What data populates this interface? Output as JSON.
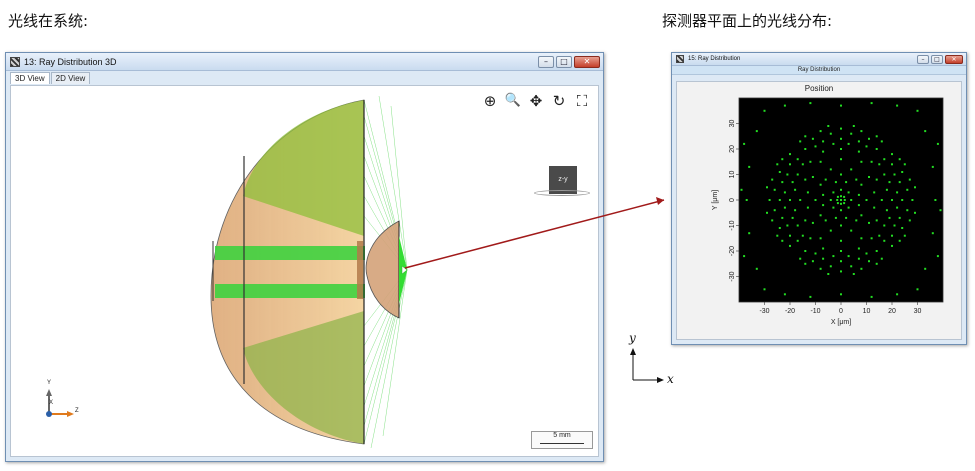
{
  "captions": {
    "left": "光线在系统:",
    "right": "探测器平面上的光线分布:"
  },
  "window_3d": {
    "title": "13: Ray Distribution 3D",
    "tabs": [
      "3D View",
      "2D View"
    ],
    "active_tab": "3D View",
    "buttons": {
      "minimize": "–",
      "maximize": "□",
      "close": "✕"
    },
    "toolbar": [
      {
        "name": "zoom-window-icon",
        "glyph": "⊕"
      },
      {
        "name": "zoom-icon",
        "glyph": "🔍"
      },
      {
        "name": "pan-icon",
        "glyph": "✥"
      },
      {
        "name": "rotate-icon",
        "glyph": "↻"
      },
      {
        "name": "fit-view-icon",
        "glyph": "⛶"
      }
    ],
    "viewcube_label": "z-y",
    "triad": {
      "y": "Y",
      "x": "X",
      "z": "Z"
    },
    "scalebar_label": "5 mm",
    "colors": {
      "lens_fill": "#e8b27a",
      "ray": "#22cc22",
      "lens_edge": "#222222"
    }
  },
  "window_detector": {
    "title": "15: Ray Distribution",
    "header": "Ray Distribution",
    "buttons": {
      "minimize": "–",
      "maximize": "□",
      "close": "✕"
    }
  },
  "chart_data": {
    "type": "scatter",
    "title": "Position",
    "xlabel": "X [μm]",
    "ylabel": "Y [μm]",
    "xlim": [
      -40,
      40
    ],
    "ylim": [
      -40,
      40
    ],
    "xticks": [
      -30,
      -20,
      -10,
      0,
      10,
      20,
      30
    ],
    "yticks": [
      30,
      20,
      10,
      0,
      -10,
      -20,
      -30
    ],
    "background": "#000000",
    "point_color": "#22dd22",
    "grid": false,
    "legend": "none",
    "points": [
      [
        0,
        0
      ],
      [
        1.5,
        0
      ],
      [
        -1.5,
        0
      ],
      [
        0,
        1.5
      ],
      [
        0,
        -1.5
      ],
      [
        1.2,
        1.2
      ],
      [
        -1.2,
        1.2
      ],
      [
        1.2,
        -1.2
      ],
      [
        -1.2,
        -1.2
      ],
      [
        4,
        0
      ],
      [
        -4,
        0
      ],
      [
        0,
        4
      ],
      [
        0,
        -4
      ],
      [
        3,
        3
      ],
      [
        -3,
        3
      ],
      [
        3,
        -3
      ],
      [
        -3,
        -3
      ],
      [
        7,
        2
      ],
      [
        -7,
        2
      ],
      [
        7,
        -2
      ],
      [
        -7,
        -2
      ],
      [
        2,
        7
      ],
      [
        -2,
        7
      ],
      [
        2,
        -7
      ],
      [
        -2,
        -7
      ],
      [
        10,
        0
      ],
      [
        -10,
        0
      ],
      [
        0,
        10
      ],
      [
        0,
        -10
      ],
      [
        8,
        6
      ],
      [
        -8,
        6
      ],
      [
        8,
        -6
      ],
      [
        -8,
        -6
      ],
      [
        6,
        8
      ],
      [
        -6,
        8
      ],
      [
        6,
        -8
      ],
      [
        -6,
        -8
      ],
      [
        13,
        3
      ],
      [
        -13,
        3
      ],
      [
        13,
        -3
      ],
      [
        -13,
        -3
      ],
      [
        11,
        9
      ],
      [
        -11,
        9
      ],
      [
        11,
        -9
      ],
      [
        -11,
        -9
      ],
      [
        4,
        12
      ],
      [
        -4,
        12
      ],
      [
        4,
        -12
      ],
      [
        -4,
        -12
      ],
      [
        16,
        0
      ],
      [
        -16,
        0
      ],
      [
        0,
        16
      ],
      [
        0,
        -16
      ],
      [
        14,
        8
      ],
      [
        -14,
        8
      ],
      [
        14,
        -8
      ],
      [
        -14,
        -8
      ],
      [
        8,
        15
      ],
      [
        -8,
        15
      ],
      [
        8,
        -15
      ],
      [
        -8,
        -15
      ],
      [
        18,
        4
      ],
      [
        -18,
        4
      ],
      [
        18,
        -4
      ],
      [
        -18,
        -4
      ],
      [
        17,
        10
      ],
      [
        -17,
        10
      ],
      [
        17,
        -10
      ],
      [
        -17,
        -10
      ],
      [
        12,
        15
      ],
      [
        -12,
        15
      ],
      [
        12,
        -15
      ],
      [
        -12,
        -15
      ],
      [
        20,
        0
      ],
      [
        -20,
        0
      ],
      [
        0,
        20
      ],
      [
        0,
        -20
      ],
      [
        19,
        7
      ],
      [
        -19,
        7
      ],
      [
        19,
        -7
      ],
      [
        -19,
        -7
      ],
      [
        15,
        14
      ],
      [
        -15,
        14
      ],
      [
        15,
        -14
      ],
      [
        -15,
        -14
      ],
      [
        7,
        19
      ],
      [
        -7,
        19
      ],
      [
        7,
        -19
      ],
      [
        -7,
        -19
      ],
      [
        22,
        3
      ],
      [
        -22,
        3
      ],
      [
        22,
        -3
      ],
      [
        -22,
        -3
      ],
      [
        21,
        10
      ],
      [
        -21,
        10
      ],
      [
        21,
        -10
      ],
      [
        -21,
        -10
      ],
      [
        17,
        16
      ],
      [
        -17,
        16
      ],
      [
        17,
        -16
      ],
      [
        -17,
        -16
      ],
      [
        10,
        21
      ],
      [
        -10,
        21
      ],
      [
        10,
        -21
      ],
      [
        -10,
        -21
      ],
      [
        3,
        22
      ],
      [
        -3,
        22
      ],
      [
        3,
        -22
      ],
      [
        -3,
        -22
      ],
      [
        24,
        0
      ],
      [
        -24,
        0
      ],
      [
        0,
        24
      ],
      [
        0,
        -24
      ],
      [
        23,
        7
      ],
      [
        -23,
        7
      ],
      [
        23,
        -7
      ],
      [
        -23,
        -7
      ],
      [
        20,
        14
      ],
      [
        -20,
        14
      ],
      [
        20,
        -14
      ],
      [
        -20,
        -14
      ],
      [
        14,
        20
      ],
      [
        -14,
        20
      ],
      [
        14,
        -20
      ],
      [
        -14,
        -20
      ],
      [
        7,
        23
      ],
      [
        -7,
        23
      ],
      [
        7,
        -23
      ],
      [
        -7,
        -23
      ],
      [
        26,
        4
      ],
      [
        -26,
        4
      ],
      [
        26,
        -4
      ],
      [
        -26,
        -4
      ],
      [
        24,
        11
      ],
      [
        -24,
        11
      ],
      [
        24,
        -11
      ],
      [
        -24,
        -11
      ],
      [
        20,
        18
      ],
      [
        -20,
        18
      ],
      [
        20,
        -18
      ],
      [
        -20,
        -18
      ],
      [
        11,
        24
      ],
      [
        -11,
        24
      ],
      [
        11,
        -24
      ],
      [
        -11,
        -24
      ],
      [
        4,
        26
      ],
      [
        -4,
        26
      ],
      [
        4,
        -26
      ],
      [
        -4,
        -26
      ],
      [
        28,
        0
      ],
      [
        -28,
        0
      ],
      [
        0,
        28
      ],
      [
        0,
        -28
      ],
      [
        27,
        8
      ],
      [
        -27,
        8
      ],
      [
        27,
        -8
      ],
      [
        -27,
        -8
      ],
      [
        23,
        16
      ],
      [
        -23,
        16
      ],
      [
        23,
        -16
      ],
      [
        -23,
        -16
      ],
      [
        16,
        23
      ],
      [
        -16,
        23
      ],
      [
        16,
        -23
      ],
      [
        -16,
        -23
      ],
      [
        8,
        27
      ],
      [
        -8,
        27
      ],
      [
        8,
        -27
      ],
      [
        -8,
        -27
      ],
      [
        29,
        5
      ],
      [
        -29,
        5
      ],
      [
        29,
        -5
      ],
      [
        -29,
        -5
      ],
      [
        25,
        14
      ],
      [
        -25,
        14
      ],
      [
        25,
        -14
      ],
      [
        -25,
        -14
      ],
      [
        14,
        25
      ],
      [
        -14,
        25
      ],
      [
        14,
        -25
      ],
      [
        -14,
        -25
      ],
      [
        5,
        29
      ],
      [
        -5,
        29
      ],
      [
        5,
        -29
      ],
      [
        -5,
        -29
      ],
      [
        38,
        22
      ],
      [
        -38,
        22
      ],
      [
        38,
        -22
      ],
      [
        -38,
        -22
      ],
      [
        36,
        13
      ],
      [
        -36,
        13
      ],
      [
        36,
        -13
      ],
      [
        -36,
        -13
      ],
      [
        39,
        -4
      ],
      [
        -39,
        4
      ],
      [
        30,
        35
      ],
      [
        -30,
        35
      ],
      [
        30,
        -35
      ],
      [
        -30,
        -35
      ],
      [
        12,
        38
      ],
      [
        -12,
        38
      ],
      [
        12,
        -38
      ],
      [
        -12,
        -38
      ],
      [
        22,
        37
      ],
      [
        -22,
        37
      ],
      [
        22,
        -37
      ],
      [
        -22,
        -37
      ],
      [
        33,
        27
      ],
      [
        -33,
        27
      ],
      [
        33,
        -27
      ],
      [
        -33,
        -27
      ],
      [
        0,
        37
      ],
      [
        0,
        -37
      ],
      [
        37,
        0
      ],
      [
        -37,
        0
      ]
    ]
  }
}
